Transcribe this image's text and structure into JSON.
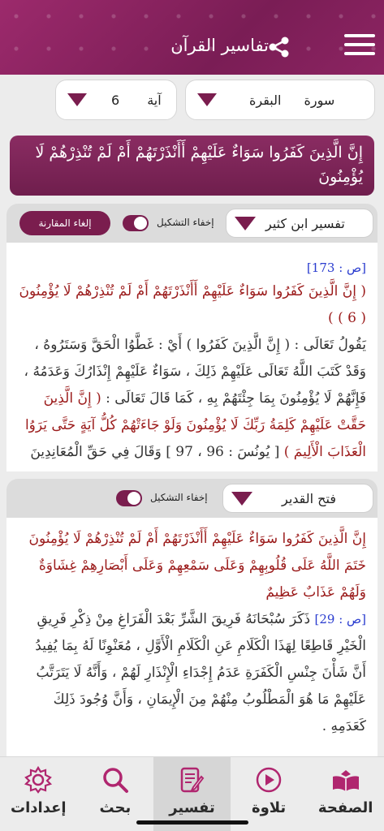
{
  "header": {
    "title": "تفاسير القرآن"
  },
  "selectors": {
    "sura_label": "سورة",
    "sura_value": "البقرة",
    "aya_label": "آية",
    "aya_value": "6"
  },
  "verse": "إِنَّ الَّذِينَ كَفَرُوا سَوَاءٌ عَلَيْهِمْ أَأَنْذَرْتَهُمْ أَمْ لَمْ تُنْذِرْهُمْ لَا يُؤْمِنُونَ",
  "panel1": {
    "tafsir_name": "تفسير ابن كثير",
    "toggle_label": "إخفاء التشكيل",
    "cancel_label": "إلغاء المقارنة",
    "page_ref": "[ص : 173]",
    "verse_line": "( إِنَّ الَّذِينَ كَفَرُوا سَوَاءٌ عَلَيْهِمْ أَأَنْذَرْتَهُمْ أَمْ لَمْ تُنْذِرْهُمْ لَا يُؤْمِنُونَ ( 6 ) )",
    "text_a": "يَقُولُ تَعَالَى : ( إِنَّ الَّذِينَ كَفَرُوا ) أَيْ : غَطَّوُا الْحَقَّ وَسَتَرُوهُ ، وَقَدْ كَتَبَ اللَّهُ تَعَالَى عَلَيْهِمْ ذَلِكَ ، سَوَاءٌ عَلَيْهِمْ إِنْذَارُكَ وَعَدَمُهُ ، فَإِنَّهُمْ لَا يُؤْمِنُونَ بِمَا جِئْتَهُمْ بِهِ ، كَمَا قَالَ تَعَالَى :",
    "text_red": "( إِنَّ الَّذِينَ حَقَّتْ عَلَيْهِمْ كَلِمَةُ رَبِّكَ لَا يُؤْمِنُونَ وَلَوْ جَاءَتْهُمْ كُلُّ آيَةٍ حَتَّى يَرَوُا الْعَذَابَ الْأَلِيمَ )",
    "text_b": "[ يُونُسَ : 96 ، 97 ] وَقَالَ فِي حَقِّ الْمُعَانِدِينَ"
  },
  "panel2": {
    "tafsir_name": "فتح القدير",
    "toggle_label": "إخفاء التشكيل",
    "verse_text": "إِنَّ الَّذِينَ كَفَرُوا سَوَاءٌ عَلَيْهِمْ أَأَنْذَرْتَهُمْ أَمْ لَمْ تُنْذِرْهُمْ لَا يُؤْمِنُونَ خَتَمَ اللَّهُ عَلَى قُلُوبِهِمْ وَعَلَى سَمْعِهِمْ وَعَلَى أَبْصَارِهِمْ غِشَاوَةٌ وَلَهُمْ عَذَابٌ عَظِيمٌ",
    "page_ref": "[ص : 29]",
    "text_a": "ذَكَرَ سُبْحَانَهُ فَرِيقَ الشَّرِّ بَعْدَ الْفَرَاغِ مِنْ ذِكْرِ فَرِيقِ الْخَيْرِ قَاطِعًا لِهَذَا الْكَلَامِ عَنِ الْكَلَامِ الْأَوَّلِ ، مُعَنْوِنًا لَهُ بِمَا يُفِيدُ أَنَّ شَأْنَ جِنْسِ الْكَفَرَةِ عَدَمُ إِجْدَاءِ الْإِنْذَارِ لَهُمْ ، وَأَنَّهُ لَا يَتَرَتَّبُ عَلَيْهِمْ مَا هُوَ الْمَطْلُوبُ مِنْهُمْ مِنَ الْإِيمَانِ ، وَأَنَّ وُجُودَ ذَلِكَ كَعَدَمِهِ ."
  },
  "nav": {
    "home": "الصفحة",
    "recitation": "تلاوة",
    "tafsir": "تفسير",
    "search": "بحث",
    "settings": "إعدادات"
  },
  "colors": {
    "primary": "#7a1d4e",
    "header": "#8c2462",
    "verse_red": "#9b1b1b",
    "ref_blue": "#2a3ccf"
  }
}
